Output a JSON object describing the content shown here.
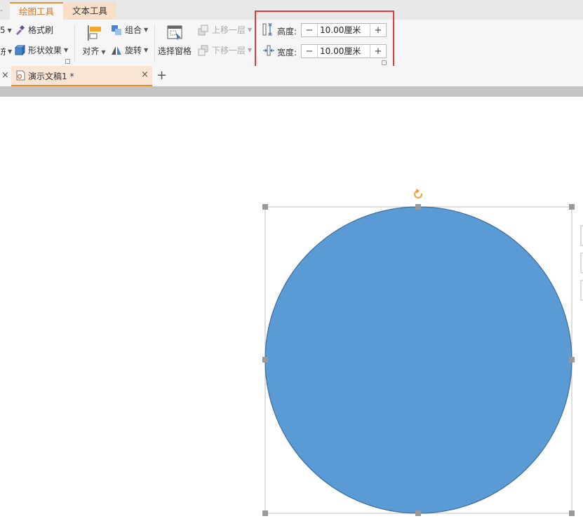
{
  "tabs": {
    "drawing_tools": "绘图工具",
    "text_tools": "文本工具",
    "left_stub": "-"
  },
  "ribbon": {
    "stub_top": "5",
    "stub_bottom": "东",
    "format_painter": "格式刷",
    "shape_effects": "形状效果",
    "align": "对齐",
    "group": "组合",
    "rotate": "旋转",
    "selection_pane": "选择窗格",
    "bring_forward": "上移一层",
    "send_backward": "下移一层",
    "height_label": "高度:",
    "height_value": "10.00厘米",
    "width_label": "宽度:",
    "width_value": "10.00厘米",
    "minus": "−",
    "plus": "+"
  },
  "doc_tabs": {
    "close_left": "×",
    "doc_name": "演示文稿1 *",
    "close": "×",
    "new_tab": "+"
  },
  "shape": {
    "type": "circle",
    "fill": "#5b9bd5",
    "stroke": "#41719c",
    "handle_color": "#999999",
    "rotate_color": "#f0a030"
  },
  "colors": {
    "accent": "#e8902c",
    "highlight": "#e53935"
  }
}
